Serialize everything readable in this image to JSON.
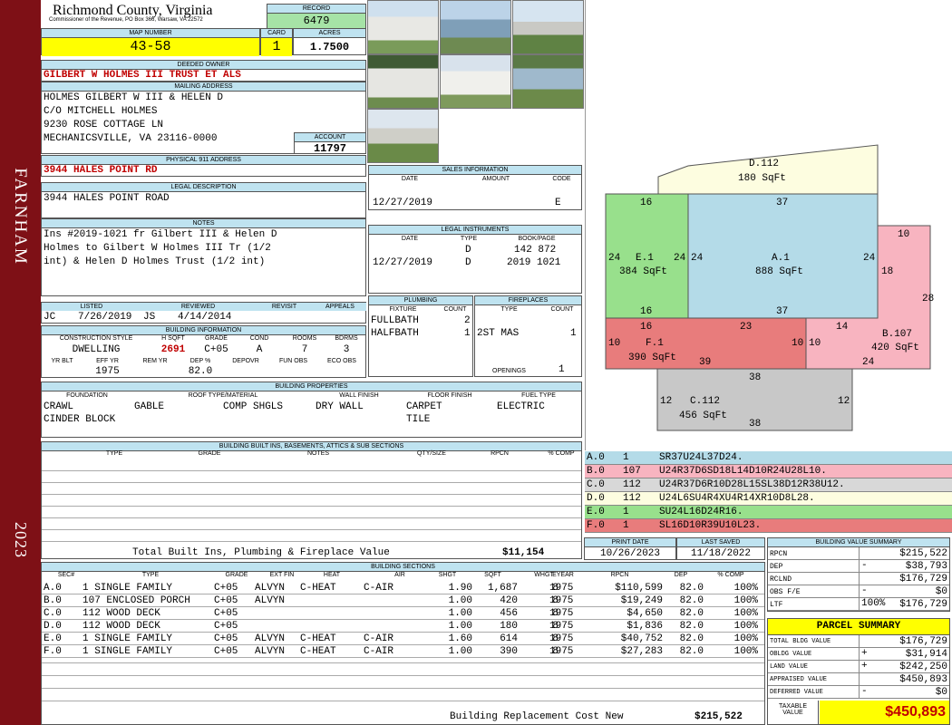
{
  "side": {
    "town": "FARNHAM",
    "year": "2023"
  },
  "header": {
    "county": "Richmond County, Virginia",
    "commissioner": "Commissioner of the Revenue, PO Box 366, Warsaw, VA 22572",
    "record_label": "RECORD",
    "record": "6479",
    "map_label": "MAP NUMBER",
    "map": "43-58",
    "card_label": "CARD",
    "card": "1",
    "acres_label": "ACRES",
    "acres": "1.7500"
  },
  "owner": {
    "deeded_label": "DEEDED OWNER",
    "deeded": "GILBERT W HOLMES III TRUST ET ALS",
    "mailing_label": "MAILING ADDRESS",
    "mailing": [
      "HOLMES GILBERT W III & HELEN D",
      "C/O MITCHELL HOLMES",
      "9230 ROSE COTTAGE LN",
      "MECHANICSVILLE, VA 23116-0000"
    ],
    "account_label": "ACCOUNT",
    "account": "11797",
    "physical_label": "PHYSICAL 911 ADDRESS",
    "physical": "3944 HALES POINT RD",
    "legal_label": "LEGAL DESCRIPTION",
    "legal": "3944 HALES POINT ROAD",
    "notes_label": "NOTES",
    "notes": [
      "Ins #2019-1021 fr Gilbert III & Helen D",
      "Holmes to Gilbert W Holmes III Tr (1/2",
      "int) & Helen D Holmes Trust (1/2 int)"
    ]
  },
  "listed": {
    "listed_label": "LISTED",
    "listed_by": "JC",
    "listed_date": "7/26/2019",
    "reviewed_label": "REVIEWED",
    "reviewed_by": "JS",
    "reviewed_date": "4/14/2014",
    "revisit_label": "REVISIT",
    "appeals_label": "APPEALS"
  },
  "building_info": {
    "title": "BUILDING INFORMATION",
    "h1": [
      "CONSTRUCTION STYLE",
      "H SQFT",
      "GRADE",
      "COND",
      "ROOMS",
      "BDRMS"
    ],
    "v1": [
      "DWELLING",
      "2691",
      "C+05",
      "A",
      "7",
      "3"
    ],
    "h2": [
      "YR BLT",
      "EFF YR",
      "REM YR",
      "DEP %",
      "DEPOVR",
      "FUN OBS",
      "ECO OBS"
    ],
    "v2": [
      "",
      "1975",
      "",
      "82.0",
      "",
      "",
      ""
    ]
  },
  "sales": {
    "title": "SALES INFORMATION",
    "headers": [
      "DATE",
      "AMOUNT",
      "CODE"
    ],
    "rows": [
      [
        "12/27/2019",
        "",
        "E"
      ]
    ]
  },
  "legal_instruments": {
    "title": "LEGAL INSTRUMENTS",
    "headers": [
      "DATE",
      "TYPE",
      "BOOK/PAGE"
    ],
    "rows": [
      [
        "",
        "D",
        "142 872"
      ],
      [
        "12/27/2019",
        "D",
        "2019 1021"
      ]
    ]
  },
  "plumbing": {
    "title": "PLUMBING",
    "headers": [
      "FIXTURE",
      "COUNT"
    ],
    "rows": [
      [
        "FULLBATH",
        "2"
      ],
      [
        "HALFBATH",
        "1"
      ]
    ]
  },
  "fireplaces": {
    "title": "FIREPLACES",
    "headers": [
      "TYPE",
      "COUNT"
    ],
    "rows": [
      [
        "2ST MAS",
        "1"
      ]
    ],
    "openings_label": "OPENINGS",
    "openings": "1"
  },
  "properties": {
    "title": "BUILDING PROPERTIES",
    "headers": [
      "FOUNDATION",
      "ROOF TYPE/MATERIAL",
      "WALL FINISH",
      "FLOOR FINISH",
      "FUEL TYPE"
    ],
    "foundation": [
      "CRAWL",
      "CINDER BLOCK"
    ],
    "roof_type": "GABLE",
    "roof_material": "COMP SHGLS",
    "wall": "DRY WALL",
    "floor": [
      "CARPET",
      "TILE"
    ],
    "fuel": "ELECTRIC"
  },
  "builtins": {
    "title": "BUILDING BUILT INS, BASEMENTS, ATTICS & SUB SECTIONS",
    "headers": [
      "TYPE",
      "GRADE",
      "NOTES",
      "QTY/SIZE",
      "RPCN",
      "% COMP"
    ],
    "total_label": "Total Built Ins, Plumbing & Fireplace Value",
    "total": "$11,154"
  },
  "sections": {
    "title": "BUILDING SECTIONS",
    "headers": [
      "SEC#",
      "TYPE",
      "GRADE",
      "EXT FIN",
      "HEAT",
      "AIR",
      "SHGT",
      "SQFT",
      "WHGT",
      "EYEAR",
      "RPCN",
      "DEP",
      "% COMP"
    ],
    "rows": [
      [
        "A.0",
        "1 SINGLE FAMILY",
        "C+05",
        "ALVYN",
        "C-HEAT",
        "C-AIR",
        "1.90",
        "1,687",
        "8",
        "1975",
        "$110,599",
        "82.0",
        "100%"
      ],
      [
        "B.0",
        "107 ENCLOSED PORCH",
        "C+05",
        "ALVYN",
        "",
        "",
        "1.00",
        "420",
        "8",
        "1975",
        "$19,249",
        "82.0",
        "100%"
      ],
      [
        "C.0",
        "112 WOOD DECK",
        "C+05",
        "",
        "",
        "",
        "1.00",
        "456",
        "8",
        "1975",
        "$4,650",
        "82.0",
        "100%"
      ],
      [
        "D.0",
        "112 WOOD DECK",
        "C+05",
        "",
        "",
        "",
        "1.00",
        "180",
        "8",
        "1975",
        "$1,836",
        "82.0",
        "100%"
      ],
      [
        "E.0",
        "1 SINGLE FAMILY",
        "C+05",
        "ALVYN",
        "C-HEAT",
        "C-AIR",
        "1.60",
        "614",
        "8",
        "1975",
        "$40,752",
        "82.0",
        "100%"
      ],
      [
        "F.0",
        "1 SINGLE FAMILY",
        "C+05",
        "ALVYN",
        "C-HEAT",
        "C-AIR",
        "1.00",
        "390",
        "8",
        "1975",
        "$27,283",
        "82.0",
        "100%"
      ]
    ],
    "replacement_label": "Building Replacement Cost New",
    "replacement": "$215,522"
  },
  "sketch": {
    "shapes": [
      {
        "id": "D.112",
        "area": "180 SqFt",
        "color": "#fdfde0",
        "dims": []
      },
      {
        "id": "A.1",
        "area": "888 SqFt",
        "color": "#b4dbe8",
        "dims": [
          "37",
          "24",
          "37",
          "24"
        ]
      },
      {
        "id": "E.1",
        "area": "384 SqFt",
        "color": "#98e08c",
        "dims": [
          "16",
          "24",
          "16",
          "24"
        ]
      },
      {
        "id": "B.107",
        "area": "420 SqFt",
        "color": "#f8b4c0",
        "dims": [
          "10",
          "28",
          "14",
          "18",
          "24",
          "10"
        ]
      },
      {
        "id": "F.1",
        "area": "390 SqFt",
        "color": "#e87c7c",
        "dims": [
          "16",
          "23",
          "10",
          "39",
          "10"
        ]
      },
      {
        "id": "C.112",
        "area": "456 SqFt",
        "color": "#c8c8c8",
        "dims": [
          "38",
          "12",
          "38",
          "12"
        ]
      }
    ]
  },
  "legend": [
    {
      "sec": "A.0",
      "code": "1",
      "vec": "SR37U24L37D24.",
      "color": "#b4dbe8"
    },
    {
      "sec": "B.0",
      "code": "107",
      "vec": "U24R37D6SD18L14D10R24U28L10.",
      "color": "#f8b4c0"
    },
    {
      "sec": "C.0",
      "code": "112",
      "vec": "U24R37D6R10D28L15SL38D12R38U12.",
      "color": "#d8d8d8"
    },
    {
      "sec": "D.0",
      "code": "112",
      "vec": "U24L6SU4R4XU4R14XR10D8L28.",
      "color": "#fdfde0"
    },
    {
      "sec": "E.0",
      "code": "1",
      "vec": "SU24L16D24R16.",
      "color": "#98e08c"
    },
    {
      "sec": "F.0",
      "code": "1",
      "vec": "SL16D10R39U10L23.",
      "color": "#e87c7c"
    }
  ],
  "dates": {
    "print_label": "PRINT DATE",
    "print": "10/26/2023",
    "saved_label": "LAST SAVED",
    "saved": "11/18/2022"
  },
  "bvs": {
    "title": "BUILDING VALUE SUMMARY",
    "rows": [
      [
        "RPCN",
        "",
        "$215,522"
      ],
      [
        "DEP",
        "-",
        "$38,793"
      ],
      [
        "RCLND",
        "",
        "$176,729"
      ],
      [
        "OBS F/E",
        "-",
        "$0"
      ],
      [
        "LTF",
        "100%",
        "$176,729"
      ]
    ]
  },
  "parcel": {
    "title": "PARCEL SUMMARY",
    "rows": [
      [
        "TOTAL BLDG VALUE",
        "",
        "$176,729"
      ],
      [
        "OBLDG VALUE",
        "+",
        "$31,914"
      ],
      [
        "LAND VALUE",
        "+",
        "$242,250"
      ],
      [
        "APPRAISED VALUE",
        "",
        "$450,893"
      ],
      [
        "DEFERRED VALUE",
        "-",
        "$0"
      ]
    ],
    "taxable_label": [
      "TAXABLE",
      "VALUE"
    ],
    "taxable": "$450,893"
  }
}
